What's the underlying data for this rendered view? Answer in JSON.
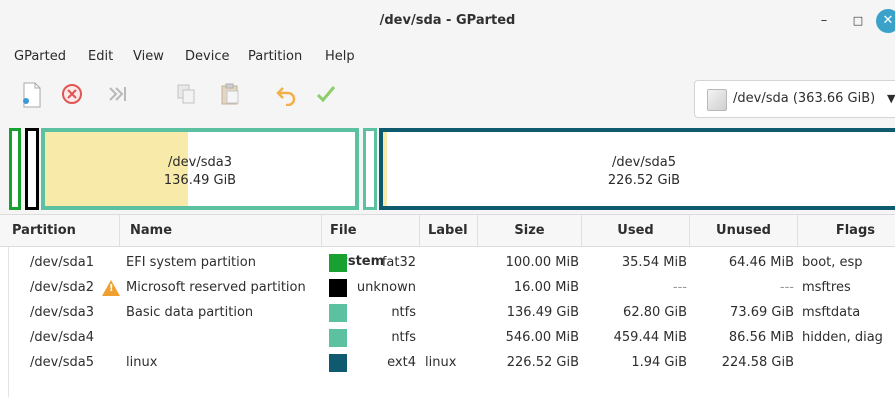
{
  "window": {
    "title": "/dev/sda - GParted",
    "minimize": "–",
    "maximize": "□",
    "close": "✕"
  },
  "menu": [
    "GParted",
    "Edit",
    "View",
    "Device",
    "Partition",
    "Help"
  ],
  "toolbar": {
    "icons": [
      "new-partition-icon",
      "delete-icon",
      "resize-move-icon",
      "copy-icon",
      "paste-icon",
      "undo-icon",
      "apply-icon"
    ]
  },
  "device": {
    "label": "/dev/sda (363.66 GiB)",
    "arrow": "▼"
  },
  "map": {
    "sda3": {
      "name": "/dev/sda3",
      "size": "136.49 GiB",
      "used_fraction": 0.46
    },
    "sda5": {
      "name": "/dev/sda5",
      "size": "226.52 GiB",
      "used_fraction": 0.0086
    }
  },
  "colors": {
    "fat32": "#18a030",
    "unknown": "#000000",
    "ntfs": "#5cc1a0",
    "ext4": "#0f5a6e",
    "used": "#f8eaa8"
  },
  "table": {
    "headers": [
      "Partition",
      "Name",
      "File System",
      "Label",
      "Size",
      "Used",
      "Unused",
      "Flags"
    ],
    "rows": [
      {
        "partition": "/dev/sda1",
        "name": "EFI system partition",
        "fs": "fat32",
        "label": "",
        "size": "100.00 MiB",
        "used": "35.54 MiB",
        "unused": "64.46 MiB",
        "flags": "boot, esp"
      },
      {
        "partition": "/dev/sda2",
        "name": "Microsoft reserved partition",
        "fs": "unknown",
        "label": "",
        "size": "16.00 MiB",
        "used": "---",
        "unused": "---",
        "flags": "msftres"
      },
      {
        "partition": "/dev/sda3",
        "name": "Basic data partition",
        "fs": "ntfs",
        "label": "",
        "size": "136.49 GiB",
        "used": "62.80 GiB",
        "unused": "73.69 GiB",
        "flags": "msftdata"
      },
      {
        "partition": "/dev/sda4",
        "name": "",
        "fs": "ntfs",
        "label": "",
        "size": "546.00 MiB",
        "used": "459.44 MiB",
        "unused": "86.56 MiB",
        "flags": "hidden, diag"
      },
      {
        "partition": "/dev/sda5",
        "name": "linux",
        "fs": "ext4",
        "label": "linux",
        "size": "226.52 GiB",
        "used": "1.94 GiB",
        "unused": "224.58 GiB",
        "flags": ""
      }
    ]
  }
}
